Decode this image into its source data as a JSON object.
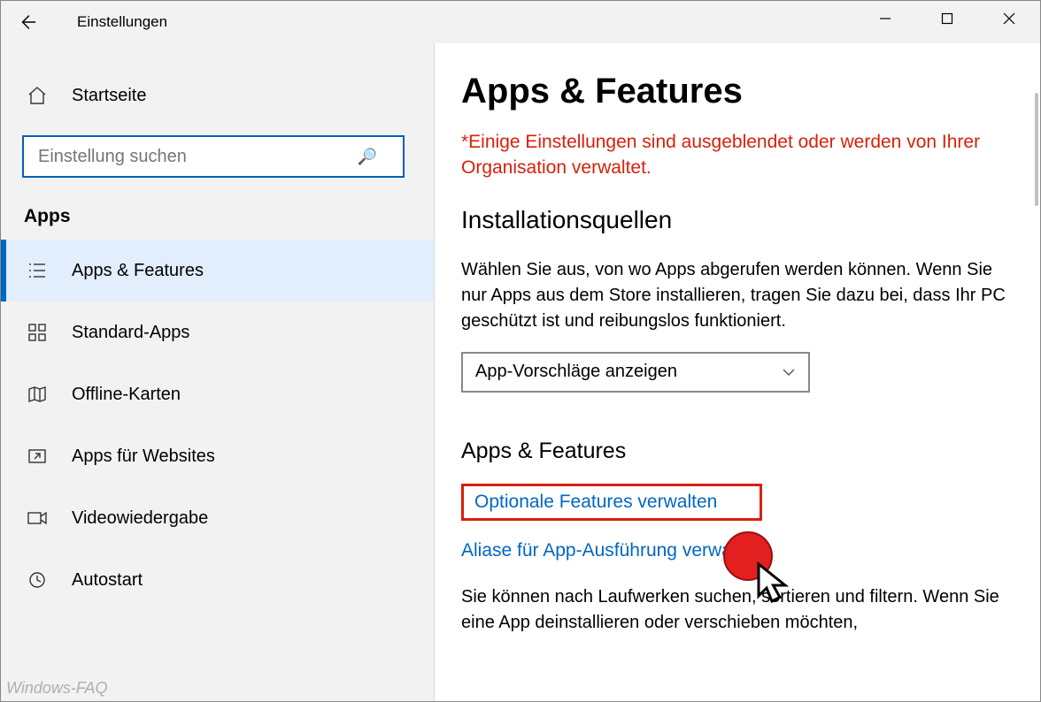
{
  "window": {
    "title": "Einstellungen"
  },
  "sidebar": {
    "home": "Startseite",
    "search_placeholder": "Einstellung suchen",
    "section": "Apps",
    "items": [
      {
        "label": "Apps & Features"
      },
      {
        "label": "Standard-Apps"
      },
      {
        "label": "Offline-Karten"
      },
      {
        "label": "Apps für Websites"
      },
      {
        "label": "Videowiedergabe"
      },
      {
        "label": "Autostart"
      }
    ]
  },
  "main": {
    "title": "Apps & Features",
    "org_warning": "*Einige Einstellungen sind ausgeblendet oder werden von Ihrer Organisation verwaltet.",
    "sources_heading": "Installationsquellen",
    "sources_text": "Wählen Sie aus, von wo Apps abgerufen werden können. Wenn Sie nur Apps aus dem Store installieren, tragen Sie dazu bei, dass Ihr PC geschützt ist und reibungslos funktioniert.",
    "dropdown_value": "App-Vorschläge anzeigen",
    "features_heading": "Apps & Features",
    "link_optional": "Optionale Features verwalten",
    "link_alias": "Aliase für App-Ausführung verwalten",
    "features_text": "Sie können nach Laufwerken suchen, sortieren und filtern. Wenn Sie eine App deinstallieren oder verschieben möchten,"
  },
  "watermark": "Windows-FAQ"
}
